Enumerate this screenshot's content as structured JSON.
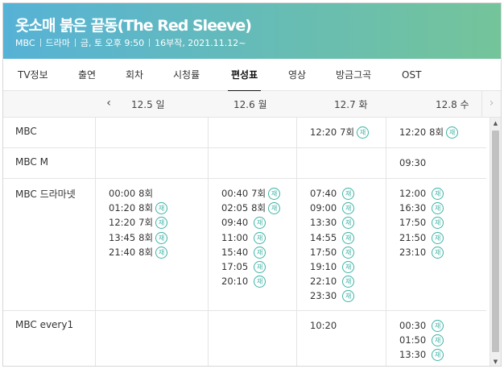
{
  "header": {
    "title": "옷소매 붉은 끝동(The Red Sleeve)",
    "meta": [
      "MBC",
      "드라마",
      "금, 토 오후 9:50",
      "16부작, 2021.11.12~"
    ],
    "gradient_from": "#56b2d6",
    "gradient_to": "#74c49a"
  },
  "tabs": [
    {
      "label": "TV정보",
      "active": false
    },
    {
      "label": "출연",
      "active": false
    },
    {
      "label": "회차",
      "active": false
    },
    {
      "label": "시청률",
      "active": false
    },
    {
      "label": "편성표",
      "active": true
    },
    {
      "label": "영상",
      "active": false
    },
    {
      "label": "방금그곡",
      "active": false
    },
    {
      "label": "OST",
      "active": false
    }
  ],
  "dates": [
    "12.5 일",
    "12.6 월",
    "12.7 화",
    "12.8 수"
  ],
  "nav": {
    "prev_icon": "chevron-left-icon",
    "next_icon": "chevron-right-icon",
    "prev_glyph": "‹",
    "next_glyph": "›"
  },
  "rerun_label": "재",
  "rerun_color": "#3cb3a5",
  "schedule": [
    {
      "channel": "MBC",
      "days": [
        [],
        [],
        [
          {
            "time": "12:20",
            "ep": "7회",
            "rerun": true
          }
        ],
        [
          {
            "time": "12:20",
            "ep": "8회",
            "rerun": true
          }
        ]
      ]
    },
    {
      "channel": "MBC M",
      "days": [
        [],
        [],
        [],
        [
          {
            "time": "09:30",
            "ep": "",
            "rerun": false
          }
        ]
      ]
    },
    {
      "channel": "MBC 드라마넷",
      "days": [
        [
          {
            "time": "00:00",
            "ep": "8회",
            "rerun": false
          },
          {
            "time": "01:20",
            "ep": "8회",
            "rerun": true
          },
          {
            "time": "12:20",
            "ep": "7회",
            "rerun": true
          },
          {
            "time": "13:45",
            "ep": "8회",
            "rerun": true
          },
          {
            "time": "21:40",
            "ep": "8회",
            "rerun": true
          }
        ],
        [
          {
            "time": "00:40",
            "ep": "7회",
            "rerun": true
          },
          {
            "time": "02:05",
            "ep": "8회",
            "rerun": true
          },
          {
            "time": "09:40",
            "ep": "",
            "rerun": true
          },
          {
            "time": "11:00",
            "ep": "",
            "rerun": true
          },
          {
            "time": "15:40",
            "ep": "",
            "rerun": true
          },
          {
            "time": "17:05",
            "ep": "",
            "rerun": true
          },
          {
            "time": "20:10",
            "ep": "",
            "rerun": true
          }
        ],
        [
          {
            "time": "07:40",
            "ep": "",
            "rerun": true
          },
          {
            "time": "09:00",
            "ep": "",
            "rerun": true
          },
          {
            "time": "13:30",
            "ep": "",
            "rerun": true
          },
          {
            "time": "14:55",
            "ep": "",
            "rerun": true
          },
          {
            "time": "17:50",
            "ep": "",
            "rerun": true
          },
          {
            "time": "19:10",
            "ep": "",
            "rerun": true
          },
          {
            "time": "22:10",
            "ep": "",
            "rerun": true
          },
          {
            "time": "23:30",
            "ep": "",
            "rerun": true
          }
        ],
        [
          {
            "time": "12:00",
            "ep": "",
            "rerun": true
          },
          {
            "time": "16:30",
            "ep": "",
            "rerun": true
          },
          {
            "time": "17:50",
            "ep": "",
            "rerun": true
          },
          {
            "time": "21:50",
            "ep": "",
            "rerun": true
          },
          {
            "time": "23:10",
            "ep": "",
            "rerun": true
          }
        ]
      ]
    },
    {
      "channel": "MBC every1",
      "days": [
        [],
        [],
        [
          {
            "time": "10:20",
            "ep": "",
            "rerun": false
          }
        ],
        [
          {
            "time": "00:30",
            "ep": "",
            "rerun": true
          },
          {
            "time": "01:50",
            "ep": "",
            "rerun": true
          },
          {
            "time": "13:30",
            "ep": "",
            "rerun": true
          }
        ]
      ]
    }
  ]
}
